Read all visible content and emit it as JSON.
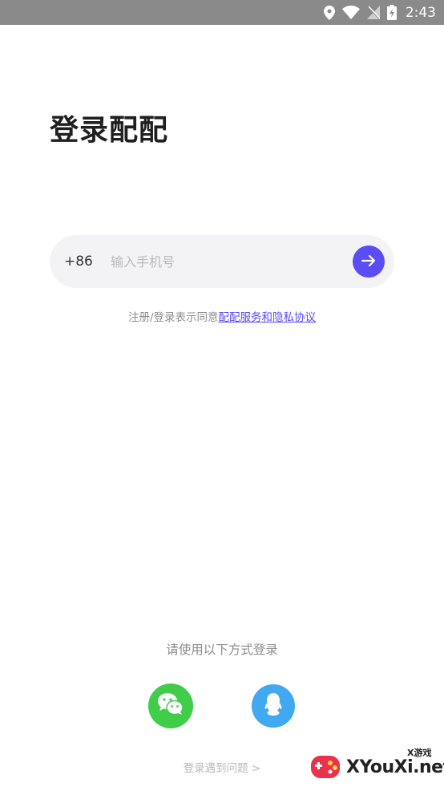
{
  "status_bar": {
    "time": "2:43",
    "icons": [
      "location-icon",
      "wifi-icon",
      "no-signal-icon",
      "battery-charging-icon"
    ]
  },
  "login": {
    "title": "登录配配",
    "country_code": "+86",
    "phone_placeholder": "输入手机号",
    "phone_value": "",
    "next_icon": "arrow-right-icon",
    "agreement_prefix": "注册/登录表示同意",
    "agreement_link": "配配服务和隐私协议"
  },
  "other_login": {
    "label": "请使用以下方式登录",
    "methods": [
      {
        "icon": "wechat-icon",
        "color": "#3fcd4a"
      },
      {
        "icon": "qq-icon",
        "color": "#41a8f2"
      }
    ],
    "trouble": "登录遇到问题 >"
  },
  "watermark": {
    "small": "X游戏",
    "main": "XYouXi.net"
  },
  "colors": {
    "accent": "#5b4cf5",
    "status_bar": "#8a8a8a",
    "field_bg": "#f3f3f5"
  }
}
